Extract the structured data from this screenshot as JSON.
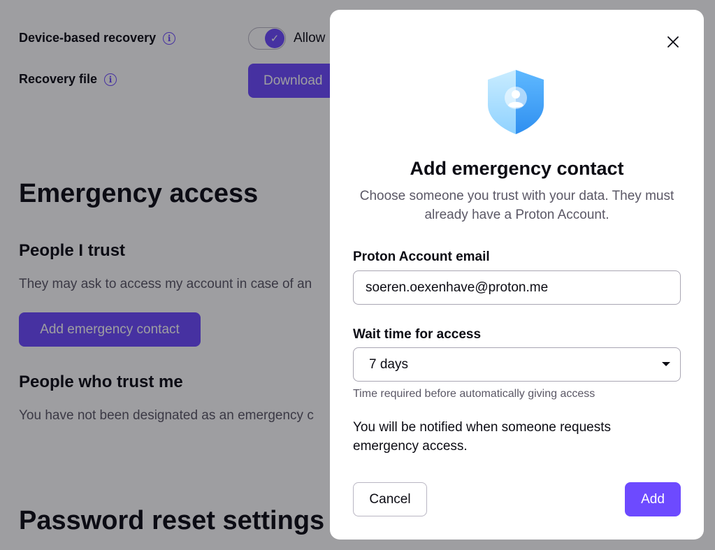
{
  "background": {
    "device_recovery": {
      "label": "Device-based recovery",
      "toggle_label": "Allow"
    },
    "recovery_file": {
      "label": "Recovery file",
      "button_label": "Download"
    },
    "emergency_access": {
      "title": "Emergency access",
      "people_i_trust": {
        "heading": "People I trust",
        "description": "They may ask to access my account in case of an",
        "add_button": "Add emergency contact"
      },
      "people_who_trust_me": {
        "heading": "People who trust me",
        "description": "You have not been designated as an emergency c"
      }
    },
    "password_reset": {
      "title": "Password reset settings"
    }
  },
  "modal": {
    "title": "Add emergency contact",
    "description": "Choose someone you trust with your data. They must already have a Proton Account.",
    "email_label": "Proton Account email",
    "email_value": "soeren.oexenhave@proton.me",
    "wait_label": "Wait time for access",
    "wait_value": "7 days",
    "wait_hint": "Time required before automatically giving access",
    "notice": "You will be notified when someone requests emergency access.",
    "cancel_label": "Cancel",
    "add_label": "Add"
  },
  "colors": {
    "accent": "#6d4aff",
    "overlay": "rgba(12,12,20,0.4)",
    "muted_text": "#5b5866"
  },
  "icons": {
    "info": "info-icon",
    "check": "check-icon",
    "close": "close-icon",
    "shield": "shield-user-icon",
    "caret": "caret-down-icon"
  }
}
